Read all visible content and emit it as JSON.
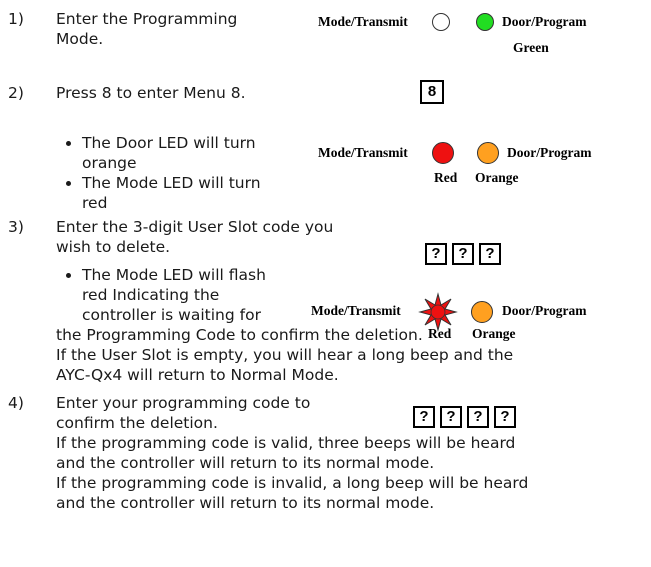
{
  "steps": [
    {
      "num": "1)",
      "lines": [
        "Enter the Programming",
        "Mode."
      ]
    },
    {
      "num": "2)",
      "lines": [
        "Press 8 to enter Menu 8."
      ]
    },
    {
      "num": "3)",
      "lines": [
        "Enter the 3-digit User Slot code you",
        "wish to delete."
      ]
    },
    {
      "num": "4)",
      "lines": [
        "Enter your programming code to",
        "confirm the deletion."
      ]
    }
  ],
  "step2_bullets": [
    {
      "lines": [
        "The Door LED will turn",
        "orange"
      ]
    },
    {
      "lines": [
        "The Mode LED will turn",
        "red"
      ]
    }
  ],
  "step3_bullet": {
    "lines": [
      "The Mode LED will flash",
      "red Indicating the",
      "controller is waiting for"
    ]
  },
  "step3_cont": [
    "the Programming Code to confirm the deletion.",
    "If the User Slot is empty, you will hear a long beep and the",
    "AYC-Qx4 will return to Normal Mode."
  ],
  "step4_cont": [
    "If the programming code is valid, three beeps will be heard",
    "and the controller will return to its normal mode.",
    "If the programming code is invalid, a long beep will be heard",
    "and the controller will return to its normal mode."
  ],
  "diagrams": {
    "mode_label": "Mode/Transmit",
    "door_label": "Door/Program",
    "d1": {
      "mode_color": "#ffffff",
      "door_color": "#22dd22",
      "door_caption": "Green"
    },
    "key8": "8",
    "d2": {
      "mode_color": "#ee1111",
      "door_color": "#ffa020",
      "mode_caption": "Red",
      "door_caption": "Orange"
    },
    "keys3": [
      "?",
      "?",
      "?"
    ],
    "d3": {
      "mode_color": "#ee1111",
      "door_color": "#ffa020",
      "mode_caption": "Red",
      "door_caption": "Orange"
    },
    "keys4": [
      "?",
      "?",
      "?",
      "?"
    ]
  }
}
